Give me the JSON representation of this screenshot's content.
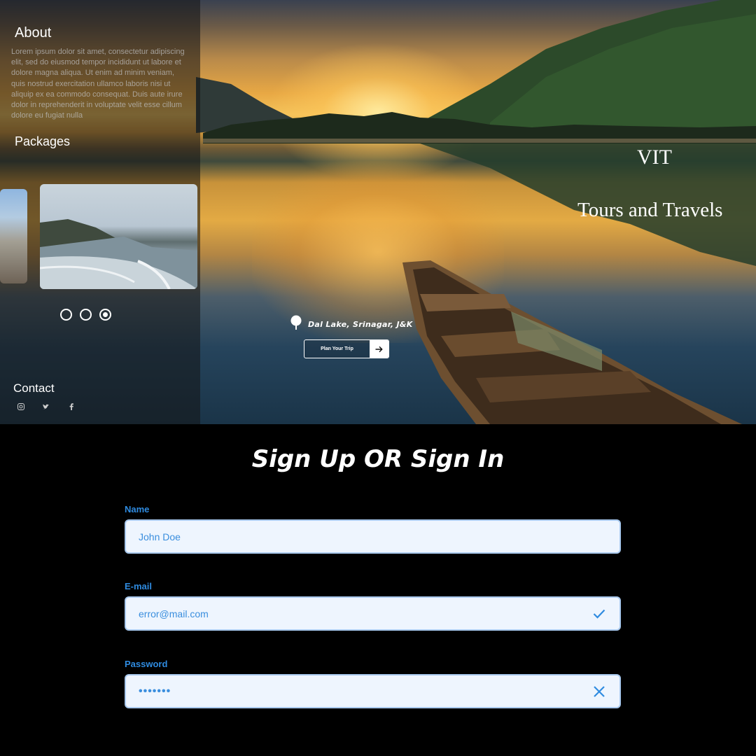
{
  "sidebar": {
    "about_heading": "About",
    "about_text": "Lorem ipsum dolor sit amet, consectetur adipiscing elit, sed do eiusmod tempor incididunt ut labore et dolore magna aliqua. Ut enim ad minim veniam, quis nostrud exercitation ullamco laboris nisi ut aliquip ex ea commodo consequat. Duis aute irure dolor in reprehenderit in voluptate velit esse cillum dolore eu fugiat nulla",
    "packages_heading": "Packages",
    "contact_heading": "Contact",
    "social": [
      "instagram-icon",
      "twitter-icon",
      "facebook-icon"
    ],
    "carousel": {
      "count": 3,
      "active_index": 2
    }
  },
  "hero": {
    "brand_title": "VIT",
    "brand_subtitle": "Tours and Travels",
    "location": "Dal Lake, Srinagar, J&K",
    "plan_button": "Plan Your Trip",
    "plan_button_icon": "arrow-right-icon"
  },
  "form": {
    "title": "Sign Up OR Sign In",
    "name": {
      "label": "Name",
      "value": "John Doe"
    },
    "email": {
      "label": "E-mail",
      "value": "error@mail.com",
      "status": "valid"
    },
    "password": {
      "label": "Password",
      "value": "•••••••",
      "status": "invalid"
    },
    "colors": {
      "label": "#2f8be0",
      "field_bg": "#eef5fe",
      "field_border": "#a9c9ee",
      "text": "#3a8ede"
    }
  }
}
